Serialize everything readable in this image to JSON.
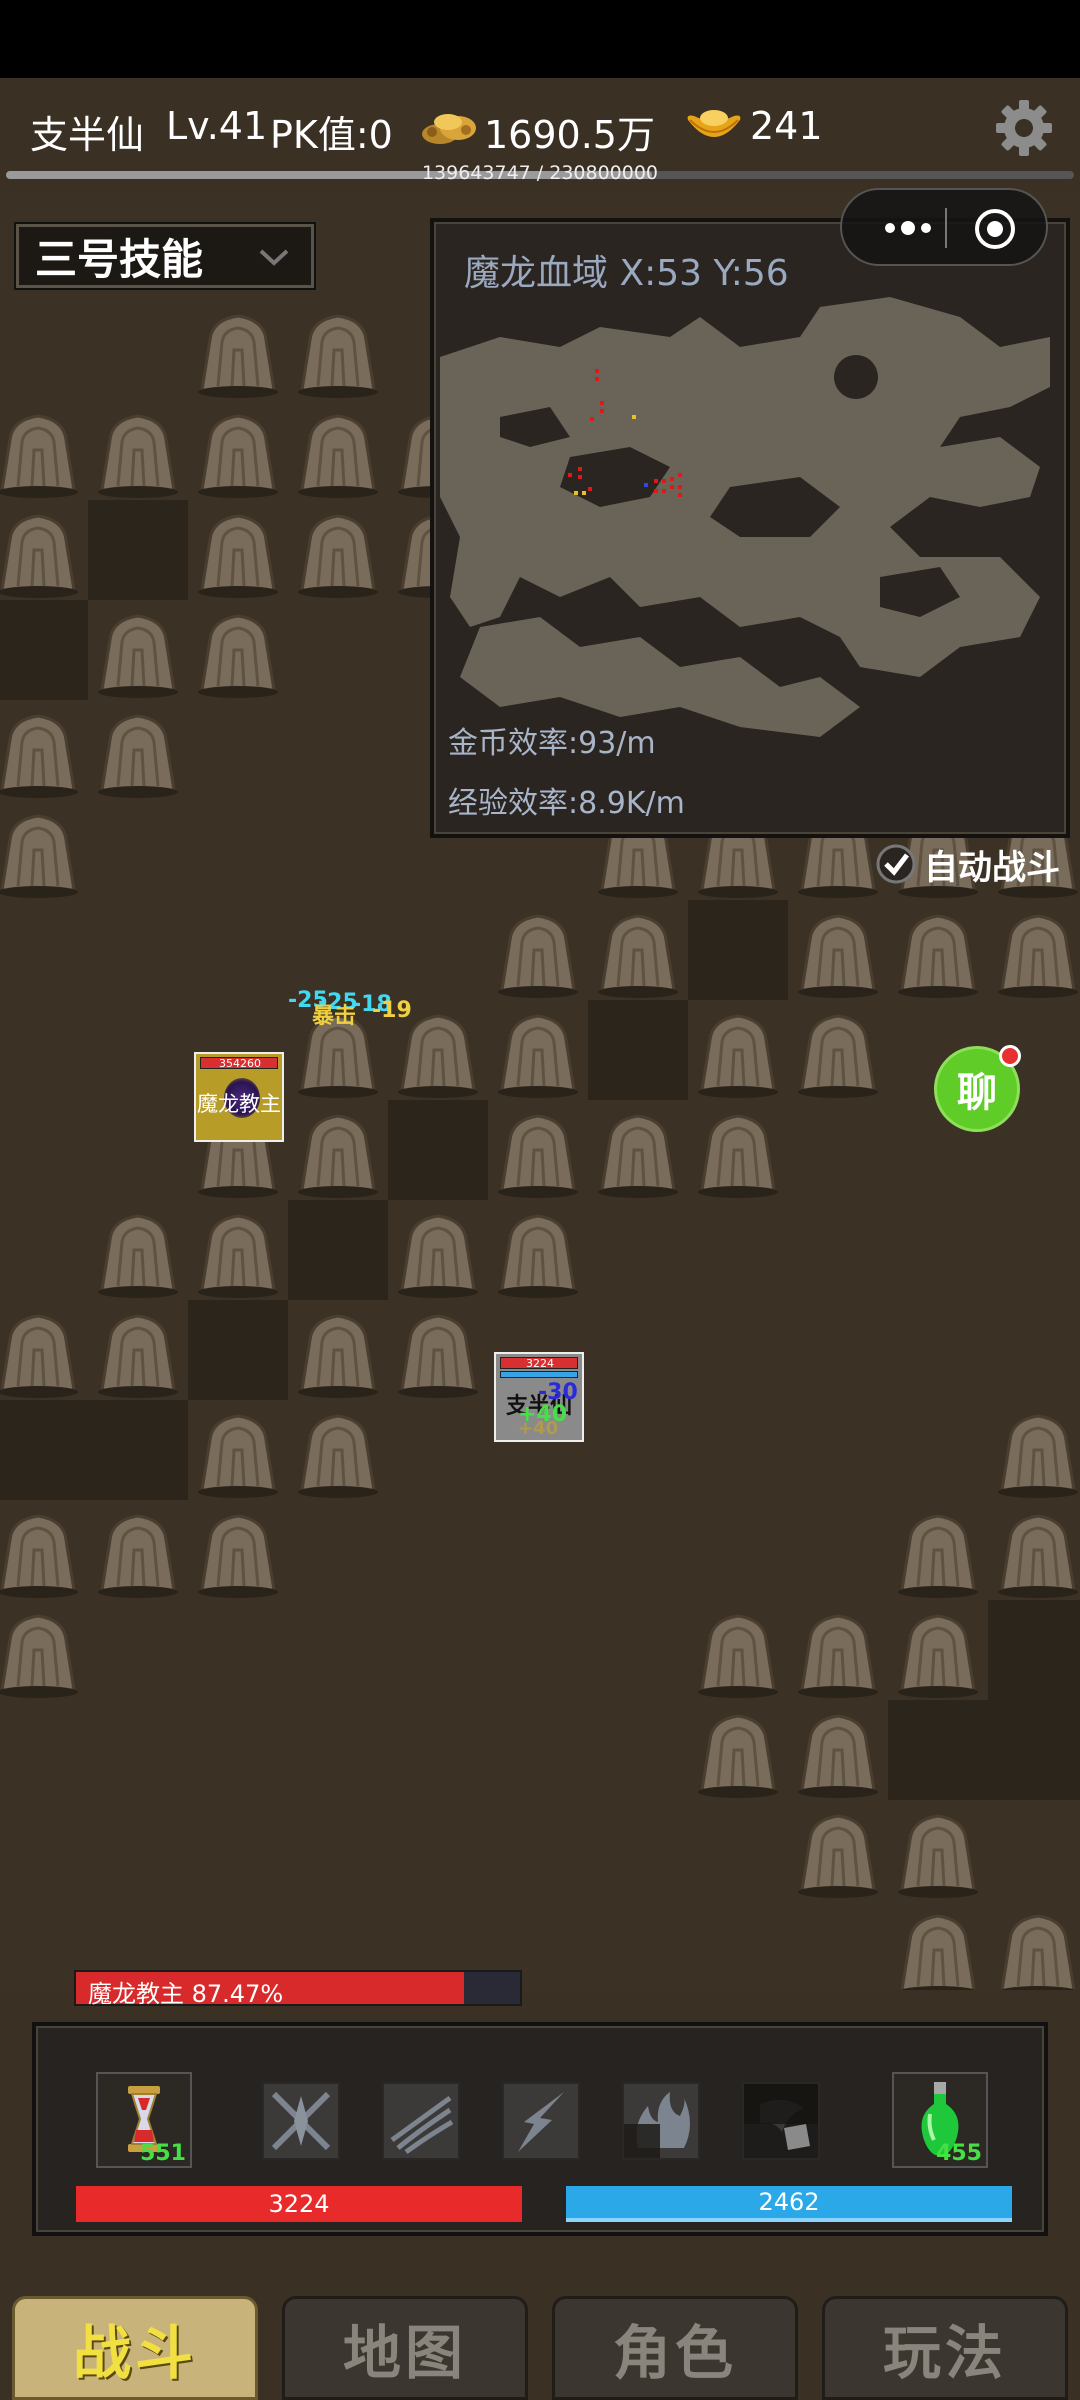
{
  "header": {
    "player_name": "支半仙",
    "level": "Lv.41",
    "pk": "PK值:0",
    "gold": "1690.5万",
    "ingots": "241",
    "exp_text": "139643747 / 230800000",
    "exp_fraction": 0.605
  },
  "skill_select": {
    "value": "三号技能"
  },
  "minimap": {
    "title": "魔龙血域 X:53 Y:56",
    "gold_rate": "金币效率:93/m",
    "exp_rate": "经验效率:8.9K/m"
  },
  "auto_battle": {
    "label": "自动战斗",
    "checked": true
  },
  "chat": {
    "label": "聊"
  },
  "boss_unit": {
    "hp": "354260",
    "name": "魔龙教主"
  },
  "player_unit": {
    "hp": "3224",
    "name": "支半仙"
  },
  "floating_text": {
    "dmg1": "-25",
    "dmg2": "-25",
    "dmg3": "-18",
    "crit": "暴击",
    "dmg4": "-19",
    "heal1": "+40",
    "heal2": "+40",
    "player_dmg": "-30"
  },
  "boss_bar": {
    "label": "魔龙教主  87.47%",
    "percent": 87.47
  },
  "panel": {
    "left_item_count": "551",
    "right_item_count": "455",
    "hp": "3224",
    "mp": "2462"
  },
  "tabs": [
    {
      "label": "战斗",
      "active": true
    },
    {
      "label": "地图",
      "active": false
    },
    {
      "label": "角色",
      "active": false
    },
    {
      "label": "玩法",
      "active": false
    }
  ],
  "colors": {
    "background": "#3a3024",
    "hp": "#e82a2a",
    "mp": "#2aa8e8",
    "active_tab_text": "#f2e042",
    "chat": "#5fcc28"
  }
}
